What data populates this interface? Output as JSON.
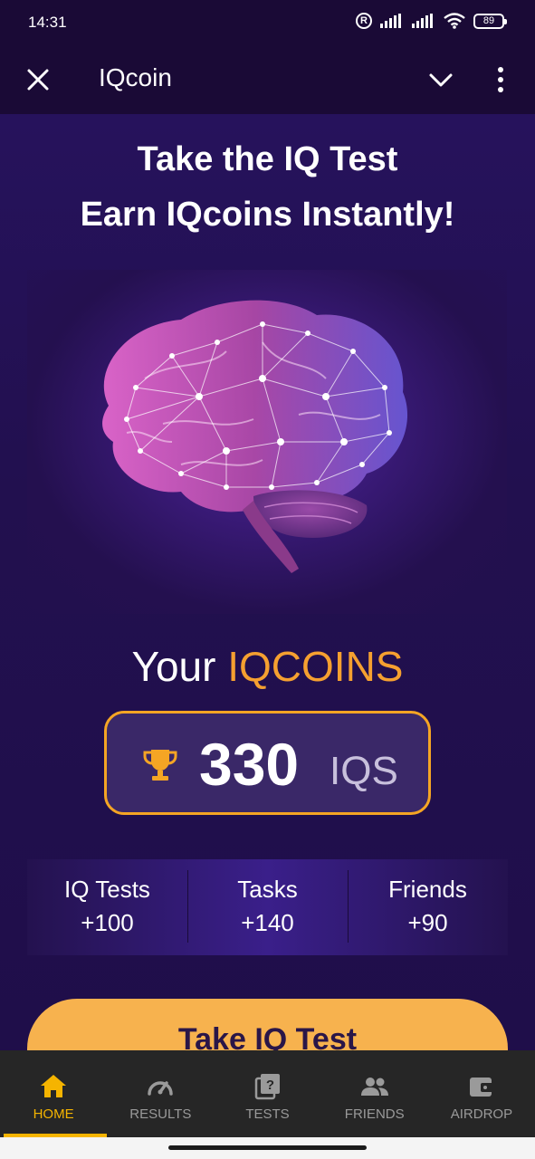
{
  "status_bar": {
    "time": "14:31",
    "battery": "89",
    "icons": [
      "registered-icon",
      "signal-icon",
      "signal-icon",
      "wifi-icon",
      "battery-icon"
    ]
  },
  "header": {
    "title": "IQcoin",
    "icons": [
      "close-icon",
      "chevron-down-icon",
      "more-vertical-icon"
    ]
  },
  "hero": {
    "line1": "Take the IQ Test",
    "line2": "Earn IQcoins Instantly!",
    "image": "brain-illustration"
  },
  "coins": {
    "prefix": "Your ",
    "highlight": "IQCOINS",
    "value": "330",
    "unit": "IQS",
    "icon": "trophy-icon"
  },
  "stats": [
    {
      "label": "IQ Tests",
      "value": "+100"
    },
    {
      "label": "Tasks",
      "value": "+140"
    },
    {
      "label": "Friends",
      "value": "+90"
    }
  ],
  "cta": {
    "label": "Take IQ Test"
  },
  "nav": [
    {
      "label": "HOME",
      "icon": "home-icon",
      "active": true
    },
    {
      "label": "RESULTS",
      "icon": "speedometer-icon",
      "active": false
    },
    {
      "label": "TESTS",
      "icon": "quiz-icon",
      "active": false
    },
    {
      "label": "FRIENDS",
      "icon": "people-icon",
      "active": false
    },
    {
      "label": "AIRDROP",
      "icon": "wallet-icon",
      "active": false
    }
  ],
  "colors": {
    "accent": "#f5a030",
    "nav_active": "#f5b400",
    "background": "#22104f",
    "cta": "#f7b24e"
  }
}
